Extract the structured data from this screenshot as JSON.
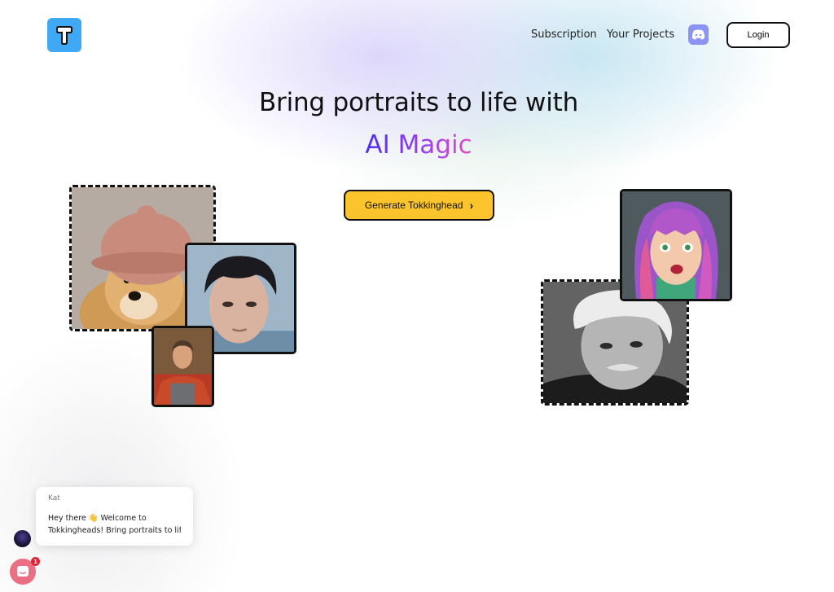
{
  "header": {
    "logo_letter": "T",
    "nav": [
      "Subscription",
      "Your Projects"
    ],
    "discord_icon": "discord-icon",
    "login_label": "Login"
  },
  "hero": {
    "title_line1": "Bring portraits to life with",
    "title_line2": "AI Magic",
    "cta_label": "Generate Tokkinghead",
    "cta_icon": "chevron-right"
  },
  "chat": {
    "agent_name": "Kat",
    "message_line1": "Hey there 👋 Welcome to",
    "message_line2": "Tokkingheads!  Bring portraits to lif...",
    "unread_count": "1"
  },
  "colors": {
    "logo_bg": "#3fa9f5",
    "cta_bg": "#fcc42c",
    "accent_gradient_start": "#4b2ff0",
    "accent_gradient_end": "#e04ec7",
    "discord": "#8b93f5",
    "chat_launcher": "#ea6f83"
  }
}
